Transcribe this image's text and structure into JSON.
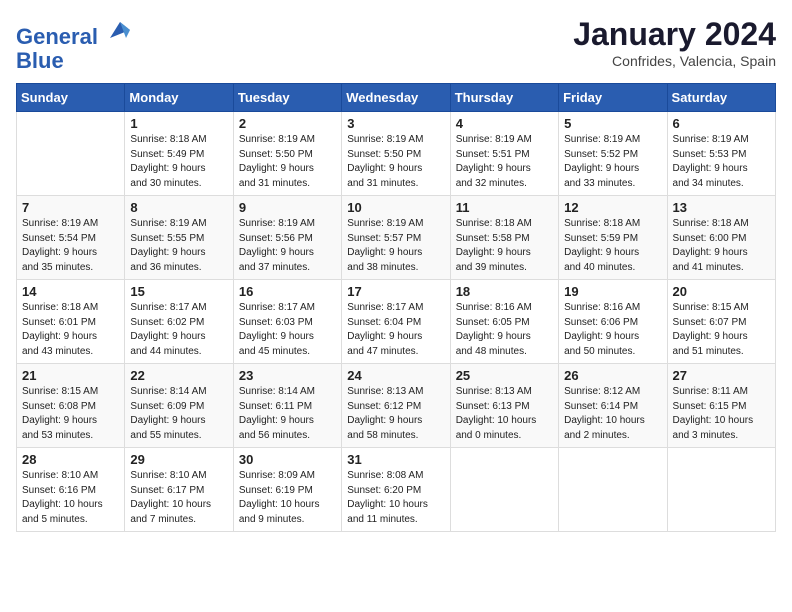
{
  "logo": {
    "line1": "General",
    "line2": "Blue"
  },
  "title": "January 2024",
  "subtitle": "Confrides, Valencia, Spain",
  "header_days": [
    "Sunday",
    "Monday",
    "Tuesday",
    "Wednesday",
    "Thursday",
    "Friday",
    "Saturday"
  ],
  "weeks": [
    [
      {
        "day": "",
        "info": ""
      },
      {
        "day": "1",
        "info": "Sunrise: 8:18 AM\nSunset: 5:49 PM\nDaylight: 9 hours\nand 30 minutes."
      },
      {
        "day": "2",
        "info": "Sunrise: 8:19 AM\nSunset: 5:50 PM\nDaylight: 9 hours\nand 31 minutes."
      },
      {
        "day": "3",
        "info": "Sunrise: 8:19 AM\nSunset: 5:50 PM\nDaylight: 9 hours\nand 31 minutes."
      },
      {
        "day": "4",
        "info": "Sunrise: 8:19 AM\nSunset: 5:51 PM\nDaylight: 9 hours\nand 32 minutes."
      },
      {
        "day": "5",
        "info": "Sunrise: 8:19 AM\nSunset: 5:52 PM\nDaylight: 9 hours\nand 33 minutes."
      },
      {
        "day": "6",
        "info": "Sunrise: 8:19 AM\nSunset: 5:53 PM\nDaylight: 9 hours\nand 34 minutes."
      }
    ],
    [
      {
        "day": "7",
        "info": "Sunrise: 8:19 AM\nSunset: 5:54 PM\nDaylight: 9 hours\nand 35 minutes."
      },
      {
        "day": "8",
        "info": "Sunrise: 8:19 AM\nSunset: 5:55 PM\nDaylight: 9 hours\nand 36 minutes."
      },
      {
        "day": "9",
        "info": "Sunrise: 8:19 AM\nSunset: 5:56 PM\nDaylight: 9 hours\nand 37 minutes."
      },
      {
        "day": "10",
        "info": "Sunrise: 8:19 AM\nSunset: 5:57 PM\nDaylight: 9 hours\nand 38 minutes."
      },
      {
        "day": "11",
        "info": "Sunrise: 8:18 AM\nSunset: 5:58 PM\nDaylight: 9 hours\nand 39 minutes."
      },
      {
        "day": "12",
        "info": "Sunrise: 8:18 AM\nSunset: 5:59 PM\nDaylight: 9 hours\nand 40 minutes."
      },
      {
        "day": "13",
        "info": "Sunrise: 8:18 AM\nSunset: 6:00 PM\nDaylight: 9 hours\nand 41 minutes."
      }
    ],
    [
      {
        "day": "14",
        "info": "Sunrise: 8:18 AM\nSunset: 6:01 PM\nDaylight: 9 hours\nand 43 minutes."
      },
      {
        "day": "15",
        "info": "Sunrise: 8:17 AM\nSunset: 6:02 PM\nDaylight: 9 hours\nand 44 minutes."
      },
      {
        "day": "16",
        "info": "Sunrise: 8:17 AM\nSunset: 6:03 PM\nDaylight: 9 hours\nand 45 minutes."
      },
      {
        "day": "17",
        "info": "Sunrise: 8:17 AM\nSunset: 6:04 PM\nDaylight: 9 hours\nand 47 minutes."
      },
      {
        "day": "18",
        "info": "Sunrise: 8:16 AM\nSunset: 6:05 PM\nDaylight: 9 hours\nand 48 minutes."
      },
      {
        "day": "19",
        "info": "Sunrise: 8:16 AM\nSunset: 6:06 PM\nDaylight: 9 hours\nand 50 minutes."
      },
      {
        "day": "20",
        "info": "Sunrise: 8:15 AM\nSunset: 6:07 PM\nDaylight: 9 hours\nand 51 minutes."
      }
    ],
    [
      {
        "day": "21",
        "info": "Sunrise: 8:15 AM\nSunset: 6:08 PM\nDaylight: 9 hours\nand 53 minutes."
      },
      {
        "day": "22",
        "info": "Sunrise: 8:14 AM\nSunset: 6:09 PM\nDaylight: 9 hours\nand 55 minutes."
      },
      {
        "day": "23",
        "info": "Sunrise: 8:14 AM\nSunset: 6:11 PM\nDaylight: 9 hours\nand 56 minutes."
      },
      {
        "day": "24",
        "info": "Sunrise: 8:13 AM\nSunset: 6:12 PM\nDaylight: 9 hours\nand 58 minutes."
      },
      {
        "day": "25",
        "info": "Sunrise: 8:13 AM\nSunset: 6:13 PM\nDaylight: 10 hours\nand 0 minutes."
      },
      {
        "day": "26",
        "info": "Sunrise: 8:12 AM\nSunset: 6:14 PM\nDaylight: 10 hours\nand 2 minutes."
      },
      {
        "day": "27",
        "info": "Sunrise: 8:11 AM\nSunset: 6:15 PM\nDaylight: 10 hours\nand 3 minutes."
      }
    ],
    [
      {
        "day": "28",
        "info": "Sunrise: 8:10 AM\nSunset: 6:16 PM\nDaylight: 10 hours\nand 5 minutes."
      },
      {
        "day": "29",
        "info": "Sunrise: 8:10 AM\nSunset: 6:17 PM\nDaylight: 10 hours\nand 7 minutes."
      },
      {
        "day": "30",
        "info": "Sunrise: 8:09 AM\nSunset: 6:19 PM\nDaylight: 10 hours\nand 9 minutes."
      },
      {
        "day": "31",
        "info": "Sunrise: 8:08 AM\nSunset: 6:20 PM\nDaylight: 10 hours\nand 11 minutes."
      },
      {
        "day": "",
        "info": ""
      },
      {
        "day": "",
        "info": ""
      },
      {
        "day": "",
        "info": ""
      }
    ]
  ]
}
